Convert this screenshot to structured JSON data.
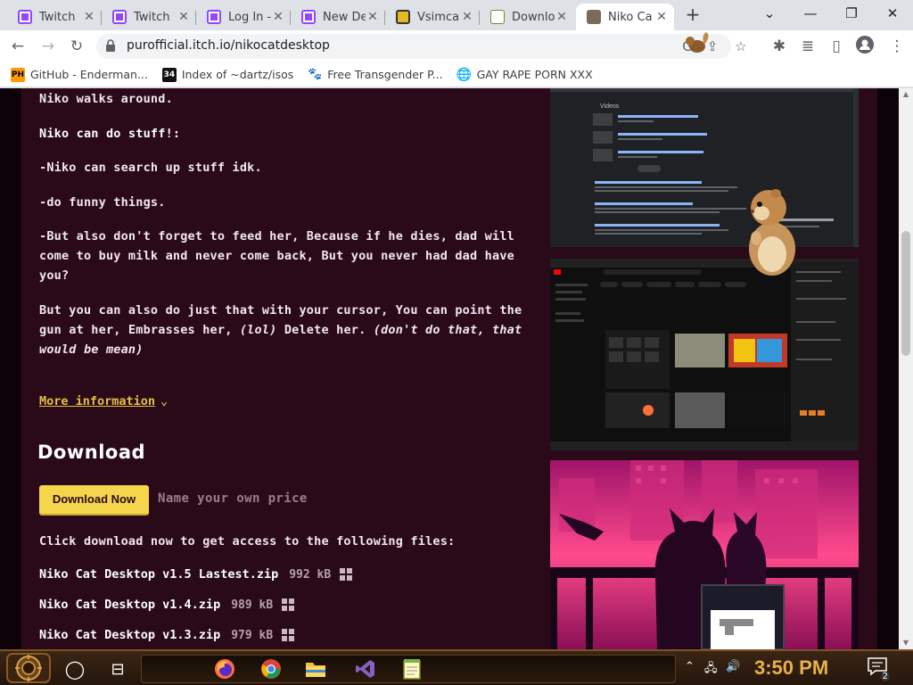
{
  "tabs": [
    {
      "title": "Twitch",
      "favicon": "twitch-icon"
    },
    {
      "title": "Twitch",
      "favicon": "twitch-icon"
    },
    {
      "title": "Log In -",
      "favicon": "twitch-icon"
    },
    {
      "title": "New De",
      "favicon": "twitch-icon"
    },
    {
      "title": "Vsimcar",
      "favicon": "vsimcard-icon"
    },
    {
      "title": "Downlo",
      "favicon": "document-icon"
    },
    {
      "title": "Niko Ca",
      "favicon": "niko-icon",
      "active": true
    }
  ],
  "toolbar": {
    "url": "purofficial.itch.io/nikocatdesktop"
  },
  "bookmarks": [
    {
      "label": "GitHub - Enderman...",
      "icon": "ph-icon",
      "icon_text": "PH"
    },
    {
      "label": "Index of ~dartz/isos",
      "icon": "index-icon",
      "icon_text": "34"
    },
    {
      "label": "Free Transgender P...",
      "icon": "paw-icon"
    },
    {
      "label": "GAY RAPE PORN XXX",
      "icon": "globe-icon"
    }
  ],
  "page": {
    "intro_line": "Niko walks around.",
    "can_do_heading": "Niko can do stuff!:",
    "bullet_1": "-Niko can search up stuff idk.",
    "bullet_2": "-do funny things.",
    "bullet_3": "-But also don't forget to feed her, Because if he dies, dad will come to buy milk and never come back, But you never had dad have you?",
    "cursor_para_1": "But you can also do just that with your cursor, You can point the gun at her, Embrasses her,",
    "cursor_para_lol": "(lol)",
    "cursor_para_2": "Delete her.",
    "cursor_para_italic": "(don't do that, that would be mean)",
    "more_info": "More information",
    "download_heading": "Download",
    "download_button": "Download Now",
    "name_price": "Name your own price",
    "click_note": "Click download now to get access to the following files:",
    "files": [
      {
        "name": "Niko Cat Desktop v1.5 Lastest.zip",
        "size": "992 kB"
      },
      {
        "name": "Niko Cat Desktop v1.4.zip",
        "size": "989 kB"
      },
      {
        "name": "Niko Cat Desktop v1.3.zip",
        "size": "979 kB"
      }
    ]
  },
  "taskbar": {
    "clock": "3:50 PM",
    "notification_count": "2"
  },
  "colors": {
    "page_bg": "#2a0a18",
    "link": "#e3c046",
    "button": "#f5d54b"
  }
}
